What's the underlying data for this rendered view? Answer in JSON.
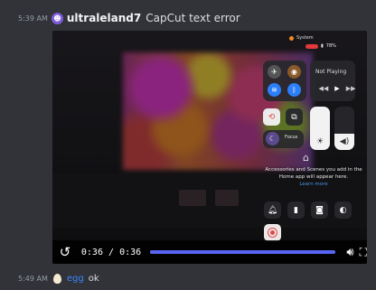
{
  "message1": {
    "timestamp": "5:39 AM",
    "username": "ultraleland7",
    "text": "CapCut text error"
  },
  "video": {
    "status_bar": {
      "focus_label": "System",
      "battery": "78%"
    },
    "control_center": {
      "now_playing": "Not Playing",
      "focus": "Focus",
      "home_message": "Accessories and Scenes you add in the Home app will appear here.",
      "home_link": "Learn more"
    },
    "player": {
      "current_time": "0:36",
      "separator": "/",
      "duration": "0:36",
      "progress_fraction": 1.0
    }
  },
  "message2": {
    "timestamp": "5:49 AM",
    "mention": "egg",
    "text": "ok"
  },
  "colors": {
    "background": "#313338",
    "accent": "#5865f2",
    "mention": "#3a86ff"
  },
  "icons": [
    "replay-icon",
    "volume-icon",
    "fullscreen-icon",
    "airplane-icon",
    "wifi-icon",
    "bluetooth-icon",
    "cellular-icon",
    "moon-icon",
    "brightness-icon",
    "home-icon",
    "flashlight-icon",
    "camera-icon",
    "bell-icon"
  ]
}
